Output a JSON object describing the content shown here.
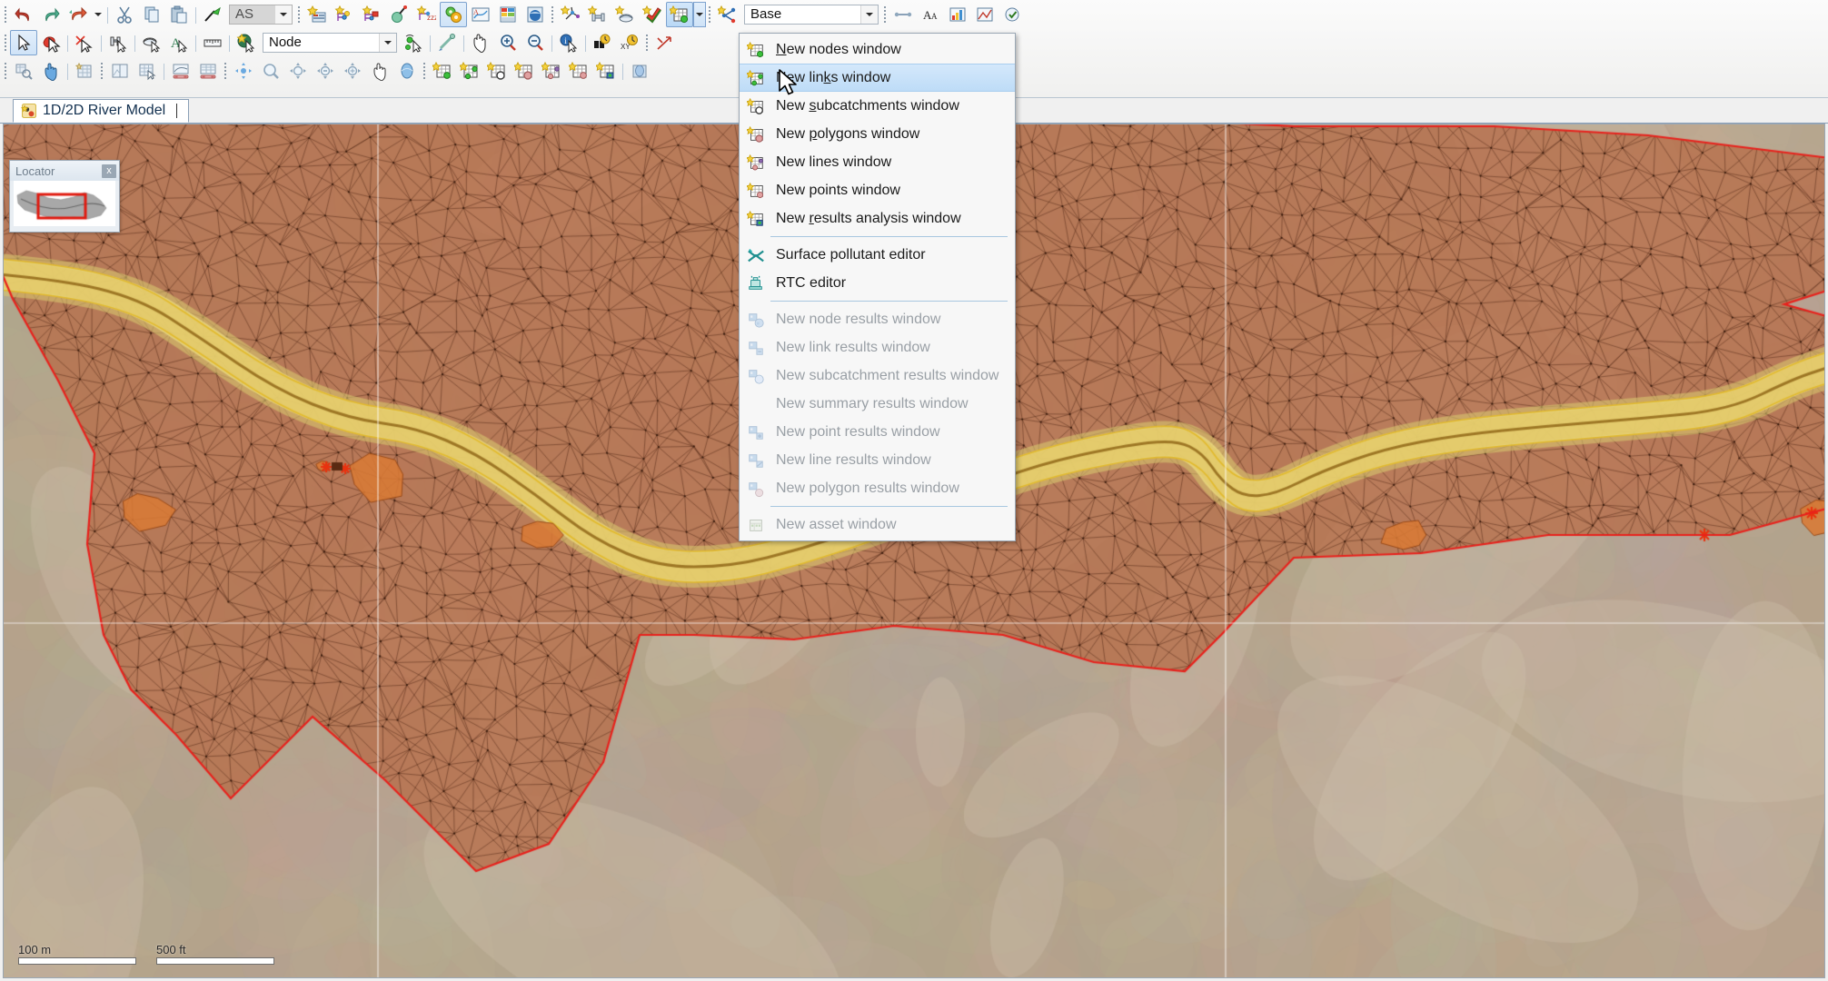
{
  "app": {
    "document_tab": "1D/2D River Model"
  },
  "toolbars": {
    "row1": [
      {
        "name": "undo-button",
        "icon": "undo-arrow-icon",
        "label": "Undo"
      },
      {
        "name": "redo-button",
        "icon": "redo-arrow-icon",
        "label": "Redo"
      },
      {
        "name": "redo-list-button",
        "icon": "redo-list-icon",
        "label": "Redo list"
      },
      {
        "name": "cut-button",
        "icon": "scissors-icon",
        "label": "Cut"
      },
      {
        "name": "copy-button",
        "icon": "copy-icon",
        "label": "Copy"
      },
      {
        "name": "paste-button",
        "icon": "paste-icon",
        "label": "Paste"
      },
      {
        "name": "flag-tool-button",
        "icon": "flag-pen-icon",
        "label": "Flag"
      },
      {
        "name": "validate-button",
        "icon": "validate-icon",
        "label": "Validate"
      },
      {
        "name": "branch-button",
        "icon": "branch-key-icon",
        "label": "Branch"
      },
      {
        "name": "branch-flag-button",
        "icon": "branch-flag-icon",
        "label": "Branch flag"
      },
      {
        "name": "commit-button",
        "icon": "commit-icon",
        "label": "Commit"
      },
      {
        "name": "version-button",
        "icon": "version-icon",
        "label": "Version"
      },
      {
        "name": "run-simulation-button",
        "icon": "gears-icon",
        "label": "Run simulation"
      },
      {
        "name": "graph-button",
        "icon": "graph-icon",
        "label": "Graph"
      },
      {
        "name": "grid-data-button",
        "icon": "grid-data-icon",
        "label": "Grid data"
      },
      {
        "name": "globe-button",
        "icon": "globe-icon",
        "label": "Globe"
      },
      {
        "name": "new-network-button",
        "icon": "new-network-icon",
        "label": "New network"
      },
      {
        "name": "new-link-button",
        "icon": "new-link-icon",
        "label": "New link"
      },
      {
        "name": "new-subcatchment-button",
        "icon": "new-subcatchment-icon",
        "label": "New subcatchment"
      },
      {
        "name": "new-check-button",
        "icon": "new-check-icon",
        "label": "New check"
      },
      {
        "name": "new-grid-window-button",
        "icon": "new-grid-window-icon",
        "label": "New window"
      },
      {
        "name": "new-scheme-button",
        "icon": "new-scheme-icon",
        "label": "New scheme"
      }
    ],
    "row2": [
      {
        "name": "select-tool-button",
        "icon": "arrow-select-icon",
        "label": "Select"
      },
      {
        "name": "select-red-tool-button",
        "icon": "arrow-select-red-icon",
        "label": "Select shape"
      },
      {
        "name": "deselect-tool-button",
        "icon": "deselect-icon",
        "label": "Deselect"
      },
      {
        "name": "move-object-button",
        "icon": "move-object-icon",
        "label": "Move object"
      },
      {
        "name": "rotate-object-button",
        "icon": "rotate-object-icon",
        "label": "Rotate object"
      },
      {
        "name": "text-tool-button",
        "icon": "text-tool-icon",
        "label": "Text"
      },
      {
        "name": "measure-tool-button",
        "icon": "ruler-icon",
        "label": "Measure"
      },
      {
        "name": "object-select-button",
        "icon": "object-select-icon",
        "label": "Object select"
      },
      {
        "name": "trace-network-button",
        "icon": "trace-network-icon",
        "label": "Trace network"
      },
      {
        "name": "connect-tool-button",
        "icon": "connect-icon",
        "label": "Connect"
      },
      {
        "name": "pan-tool-button",
        "icon": "hand-icon",
        "label": "Pan"
      },
      {
        "name": "zoom-in-button",
        "icon": "zoom-in-icon",
        "label": "Zoom in"
      },
      {
        "name": "zoom-out-button",
        "icon": "zoom-out-icon",
        "label": "Zoom out"
      },
      {
        "name": "info-tool-button",
        "icon": "info-icon",
        "label": "Info"
      },
      {
        "name": "find-button",
        "icon": "binoculars-icon",
        "label": "Find"
      },
      {
        "name": "find-xy-button",
        "icon": "find-xy-icon",
        "label": "Find XY"
      },
      {
        "name": "snap-button",
        "icon": "snap-icon",
        "label": "Snap"
      }
    ],
    "row3": [
      {
        "name": "query-button",
        "icon": "query-icon",
        "label": "Query"
      },
      {
        "name": "select-hand-button",
        "icon": "pointing-hand-icon",
        "label": "Select hand"
      },
      {
        "name": "table-view-button",
        "icon": "table-view-icon",
        "label": "Table view"
      },
      {
        "name": "split-window-button",
        "icon": "split-window-icon",
        "label": "Split window"
      },
      {
        "name": "grid-window-button",
        "icon": "grid-window-icon",
        "label": "Grid window"
      },
      {
        "name": "long-section-button",
        "icon": "long-section-icon",
        "label": "Long section"
      },
      {
        "name": "cross-section-button",
        "icon": "cross-section-icon",
        "label": "Cross section"
      },
      {
        "name": "pan-mode-button",
        "icon": "pan-mode-icon",
        "label": "Pan mode"
      },
      {
        "name": "zoom-window-button",
        "icon": "zoom-window-icon",
        "label": "Zoom window"
      },
      {
        "name": "zoom-target-button",
        "icon": "zoom-target-icon",
        "label": "Zoom target"
      },
      {
        "name": "zoom-target-minus-button",
        "icon": "zoom-target-minus-icon",
        "label": "Zoom out target"
      },
      {
        "name": "zoom-target-alt-button",
        "icon": "zoom-target-alt-icon",
        "label": "Zoom extents"
      },
      {
        "name": "grab-tool-button",
        "icon": "grab-hand-icon",
        "label": "Grab"
      },
      {
        "name": "sphere-tool-button",
        "icon": "sphere-icon",
        "label": "Sphere"
      },
      {
        "name": "nodes-grid-button",
        "icon": "nodes-grid-icon",
        "label": "Nodes grid"
      },
      {
        "name": "links-grid-button",
        "icon": "links-grid-icon",
        "label": "Links grid"
      },
      {
        "name": "subcatchments-grid-button",
        "icon": "subcatchments-grid-icon",
        "label": "Subcatchments grid"
      },
      {
        "name": "polygons-grid-button",
        "icon": "polygons-grid-icon",
        "label": "Polygons grid"
      },
      {
        "name": "lines-grid-button",
        "icon": "lines-grid-icon",
        "label": "Lines grid"
      },
      {
        "name": "points-grid-button",
        "icon": "points-grid-icon",
        "label": "Points grid"
      },
      {
        "name": "results-grid-button",
        "icon": "results-grid-icon",
        "label": "Results grid"
      },
      {
        "name": "results-window-button",
        "icon": "results-window-icon",
        "label": "Results window"
      }
    ],
    "style_combo": {
      "name": "style-combo",
      "value": "AS",
      "enabled": false
    },
    "object_combo": {
      "name": "object-type-combo",
      "value": "Node"
    },
    "scenario_combo": {
      "name": "scenario-combo",
      "value": "Base"
    },
    "blank_combo": {
      "name": "theme-combo",
      "value": ""
    }
  },
  "menu": {
    "name": "new-window-menu",
    "items": [
      {
        "label": "New nodes window",
        "accel": "n",
        "icon": "grid-node-green-icon",
        "disabled": false,
        "highlighted": false,
        "sep_after": false
      },
      {
        "label": "New links window",
        "accel": "k",
        "icon": "grid-link-green-icon",
        "disabled": false,
        "highlighted": true,
        "sep_after": false
      },
      {
        "label": "New subcatchments window",
        "accel": "s",
        "icon": "grid-subcatchment-icon",
        "disabled": false,
        "highlighted": false,
        "sep_after": false
      },
      {
        "label": "New polygons window",
        "accel": "p",
        "icon": "grid-polygon-icon",
        "disabled": false,
        "highlighted": false,
        "sep_after": false
      },
      {
        "label": "New lines window",
        "accel": "",
        "icon": "grid-line-icon",
        "disabled": false,
        "highlighted": false,
        "sep_after": false
      },
      {
        "label": "New points window",
        "accel": "",
        "icon": "grid-point-icon",
        "disabled": false,
        "highlighted": false,
        "sep_after": false
      },
      {
        "label": "New results analysis window",
        "accel": "r",
        "icon": "grid-results-icon",
        "disabled": false,
        "highlighted": false,
        "sep_after": true
      },
      {
        "label": "Surface pollutant editor",
        "accel": "",
        "icon": "surface-pollutant-icon",
        "disabled": false,
        "highlighted": false,
        "sep_after": false
      },
      {
        "label": "RTC editor",
        "accel": "",
        "icon": "rtc-editor-icon",
        "disabled": false,
        "highlighted": false,
        "sep_after": true
      },
      {
        "label": "New node results window",
        "accel": "",
        "icon": "node-results-icon",
        "disabled": true,
        "highlighted": false,
        "sep_after": false
      },
      {
        "label": "New link results window",
        "accel": "",
        "icon": "link-results-icon",
        "disabled": true,
        "highlighted": false,
        "sep_after": false
      },
      {
        "label": "New subcatchment results window",
        "accel": "",
        "icon": "subcatchment-results-icon",
        "disabled": true,
        "highlighted": false,
        "sep_after": false
      },
      {
        "label": "New summary results window",
        "accel": "",
        "icon": "",
        "disabled": true,
        "highlighted": false,
        "sep_after": false
      },
      {
        "label": "New point results window",
        "accel": "",
        "icon": "point-results-icon",
        "disabled": true,
        "highlighted": false,
        "sep_after": false
      },
      {
        "label": "New line results window",
        "accel": "",
        "icon": "line-results-icon",
        "disabled": true,
        "highlighted": false,
        "sep_after": false
      },
      {
        "label": "New polygon results window",
        "accel": "",
        "icon": "polygon-results-icon",
        "disabled": true,
        "highlighted": false,
        "sep_after": true
      },
      {
        "label": "New asset window",
        "accel": "",
        "icon": "asset-window-icon",
        "disabled": true,
        "highlighted": false,
        "sep_after": false
      }
    ]
  },
  "locator": {
    "title": "Locator",
    "close_label": "x"
  },
  "scale": {
    "metric_label": "100 m",
    "imperial_label": "500 ft"
  },
  "colors": {
    "mesh_fill": "#b5apparent",
    "floodplain": "#b9795a",
    "terrain": "#b8a68f",
    "river_channel": "#e8d77a",
    "boundary_red": "#e8211c",
    "node_orange": "#d9752f",
    "menu_highlight": "#bedcf7",
    "mesh_line": "#5a3520"
  }
}
